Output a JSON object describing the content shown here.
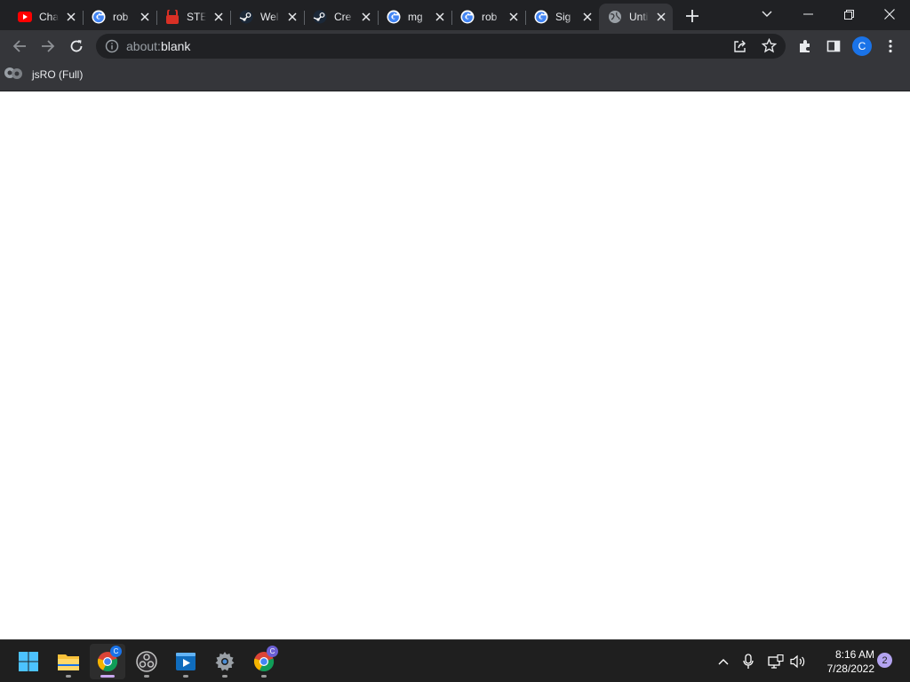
{
  "tabs": [
    {
      "title": "Cha",
      "icon": "youtube-icon"
    },
    {
      "title": "rob",
      "icon": "google-icon"
    },
    {
      "title": "STE",
      "icon": "stop-icon"
    },
    {
      "title": "Wel",
      "icon": "steam-icon"
    },
    {
      "title": "Cre",
      "icon": "steam-icon"
    },
    {
      "title": "mg",
      "icon": "google-icon"
    },
    {
      "title": "rob",
      "icon": "google-icon"
    },
    {
      "title": "Sig",
      "icon": "google-icon"
    },
    {
      "title": "Unti",
      "icon": "globe-icon",
      "active": true
    }
  ],
  "toolbar": {
    "url_scheme": "about:",
    "url_host": "blank",
    "profile_initial": "C"
  },
  "bookmarks": [
    {
      "label": "jsRO (Full)",
      "icon": "gamepad-icon"
    }
  ],
  "taskbar": {
    "apps": [
      "start-icon",
      "file-explorer-icon",
      "chrome-icon",
      "obs-icon",
      "media-player-icon",
      "settings-icon",
      "chrome-icon"
    ],
    "clock_time": "8:16 AM",
    "clock_date": "7/28/2022",
    "notification_count": "2"
  },
  "colors": {
    "frame": "#202124",
    "toolbar": "#35363a",
    "page": "#ffffff",
    "taskbar": "#1f1f1f",
    "accent": "#c9a7f0"
  }
}
